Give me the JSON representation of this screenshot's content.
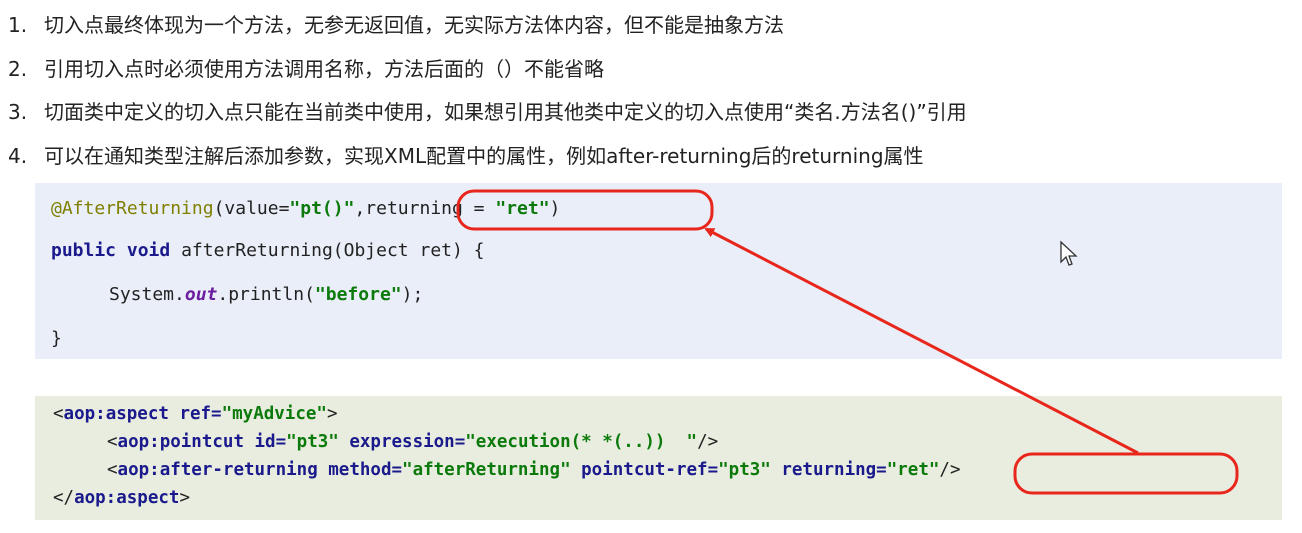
{
  "list": [
    {
      "num": "1.",
      "text": "切入点最终体现为一个方法，无参无返回值，无实际方法体内容，但不能是抽象方法"
    },
    {
      "num": "2.",
      "text": "引用切入点时必须使用方法调用名称，方法后面的（）不能省略"
    },
    {
      "num": "3.",
      "text": "切面类中定义的切入点只能在当前类中使用，如果想引用其他类中定义的切入点使用“类名.方法名()”引用"
    },
    {
      "num": "4.",
      "text": "可以在通知类型注解后添加参数，实现XML配置中的属性，例如after-returning后的returning属性"
    }
  ],
  "java": {
    "line1": {
      "annotation": "@AfterReturning",
      "open": "(value=",
      "val1": "\"pt()\"",
      "comma": ",",
      "ret_attr": "returning = ",
      "ret_val": "\"ret\"",
      "close": ")"
    },
    "line2": {
      "kw1": "public",
      "kw2": "void",
      "rest": " afterReturning(Object ret) {"
    },
    "line3": {
      "a": "System.",
      "out": "out",
      "b": ".println(",
      "str": "\"before\"",
      "c": ");"
    },
    "line4": "}"
  },
  "xml": {
    "l1": {
      "lt": "<",
      "tag": "aop:aspect",
      "attr": " ref=",
      "val": "\"myAdvice\"",
      "end": ">"
    },
    "l2": {
      "lt": "<",
      "tag": "aop:pointcut",
      "a1": " id=",
      "v1": "\"pt3\"",
      "a2": " expression=",
      "v2": "\"execution(* *(..))  \"",
      "end": "/>"
    },
    "l3": {
      "lt": "<",
      "tag": "aop:after-returning",
      "a1": " method=",
      "v1": "\"afterReturning\"",
      "a2": " pointcut-ref=",
      "v2": "\"pt3\"",
      "a3": " returning=",
      "v3": "\"ret\"",
      "end": "/>"
    },
    "l4": {
      "lt": "</",
      "tag": "aop:aspect",
      "end": ">"
    }
  },
  "annotation_color": "#e8261b",
  "icons": {
    "cursor": "mouse-pointer-icon"
  }
}
